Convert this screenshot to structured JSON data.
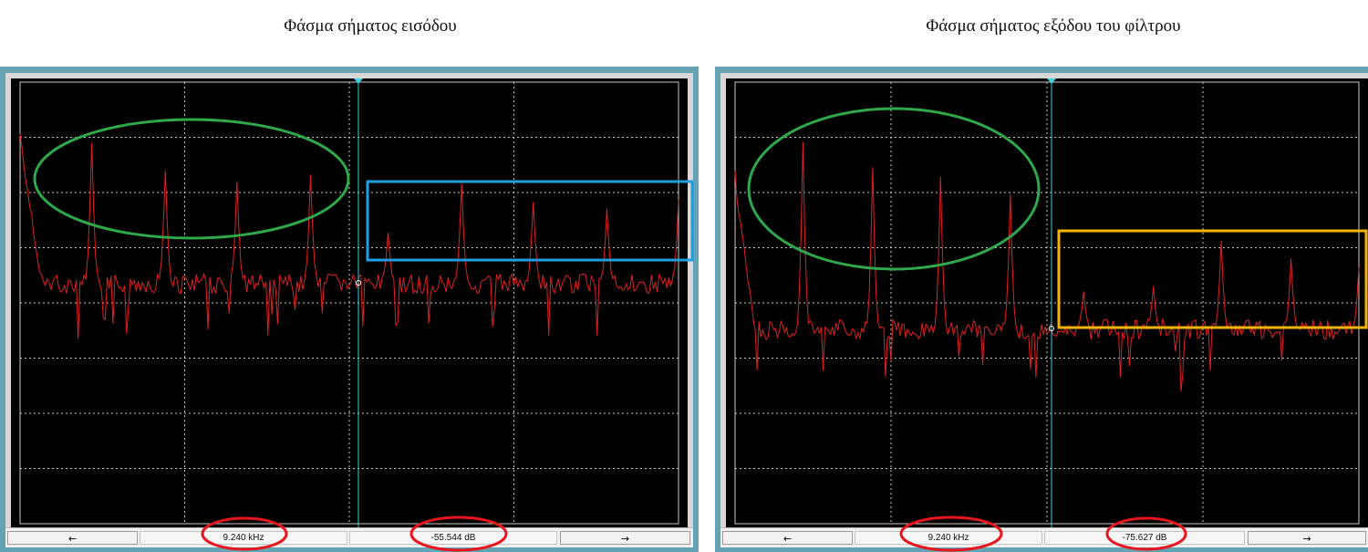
{
  "titles": {
    "left": "Φάσμα σήματος εισόδου",
    "right": "Φάσμα σήματος εξόδου του φίλτρου"
  },
  "panels": [
    {
      "id": "input",
      "frequency_readout": "9.240 kHz",
      "level_readout": "-55.544  dB",
      "left_arrow": "←",
      "right_arrow": "→"
    },
    {
      "id": "output",
      "frequency_readout": "9.240 kHz",
      "level_readout": "-75.627  dB",
      "left_arrow": "←",
      "right_arrow": "→"
    }
  ],
  "colors": {
    "frame": "#63a3b3",
    "screen": "#000000",
    "grid": "#c8c8c8",
    "trace": "#e02020",
    "cursor": "#3fd0e0",
    "green_annotation": "#2ea84a",
    "blue_annotation": "#1f9ee0",
    "yellow_annotation": "#f5b400",
    "red_annotation": "#e8151e"
  },
  "icons": [
    "cursor-marker-icon",
    "left-arrow-icon",
    "right-arrow-icon"
  ]
}
